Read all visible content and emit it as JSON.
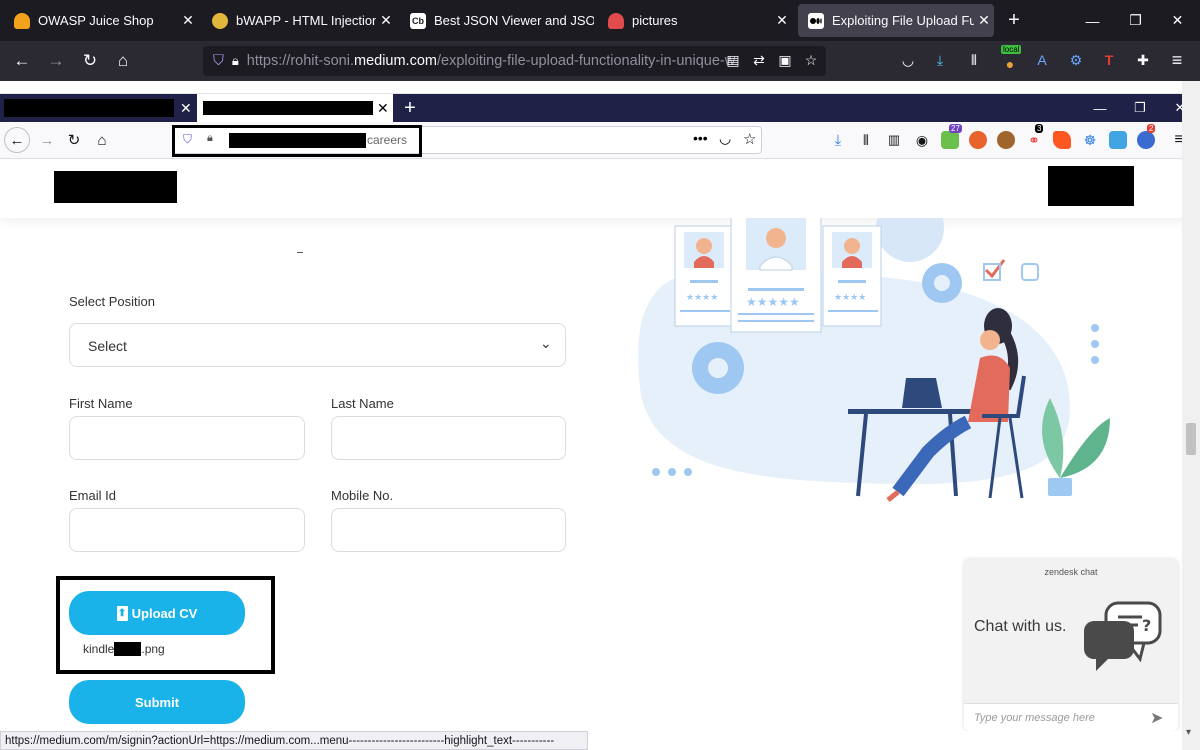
{
  "outer_tabs": [
    {
      "title": "OWASP Juice Shop",
      "icon": "juice-shop-icon",
      "icon_color": "#f4a21b"
    },
    {
      "title": "bWAPP - HTML Injection",
      "icon": "bee-icon",
      "icon_color": "#e2b53b"
    },
    {
      "title": "Best JSON Viewer and JSON B",
      "icon": "cb-logo-icon",
      "icon_color": "#ffffff",
      "icon_text": "Cb"
    },
    {
      "title": "pictures",
      "icon": "pictures-icon",
      "icon_color": "#e14b4b"
    },
    {
      "title": "Exploiting File Upload Functio",
      "icon": "medium-logo-icon",
      "icon_color": "#ffffff",
      "active": true
    }
  ],
  "outer_url": {
    "prefix": "https://rohit-soni.",
    "host": "medium.com",
    "path": "/exploiting-file-upload-functionality-in-unique-w"
  },
  "outer_badge": {
    "local": "local"
  },
  "inner_url": {
    "suffix": "careers"
  },
  "inner_badges": {
    "ext1": "27",
    "ext2": "3",
    "ext3": "2"
  },
  "form": {
    "select_position_label": "Select Position",
    "select_value": "Select",
    "first_name_label": "First Name",
    "last_name_label": "Last Name",
    "email_label": "Email Id",
    "mobile_label": "Mobile No.",
    "upload_label": "Upload CV",
    "file_name_start": "kindle",
    "file_name_end": ".png",
    "submit_label": "Submit"
  },
  "zendesk": {
    "brand": "zendesk chat",
    "heading": "Chat with us.",
    "input_placeholder": "Type your message here"
  },
  "status_url": "https://medium.com/m/signin?actionUrl=https://medium.com...menu-------------------------highlight_text-----------",
  "colors": {
    "accent": "#19b3ea",
    "illustration_blue": "#9ec8f2",
    "dark_tab": "#1c1b22"
  }
}
